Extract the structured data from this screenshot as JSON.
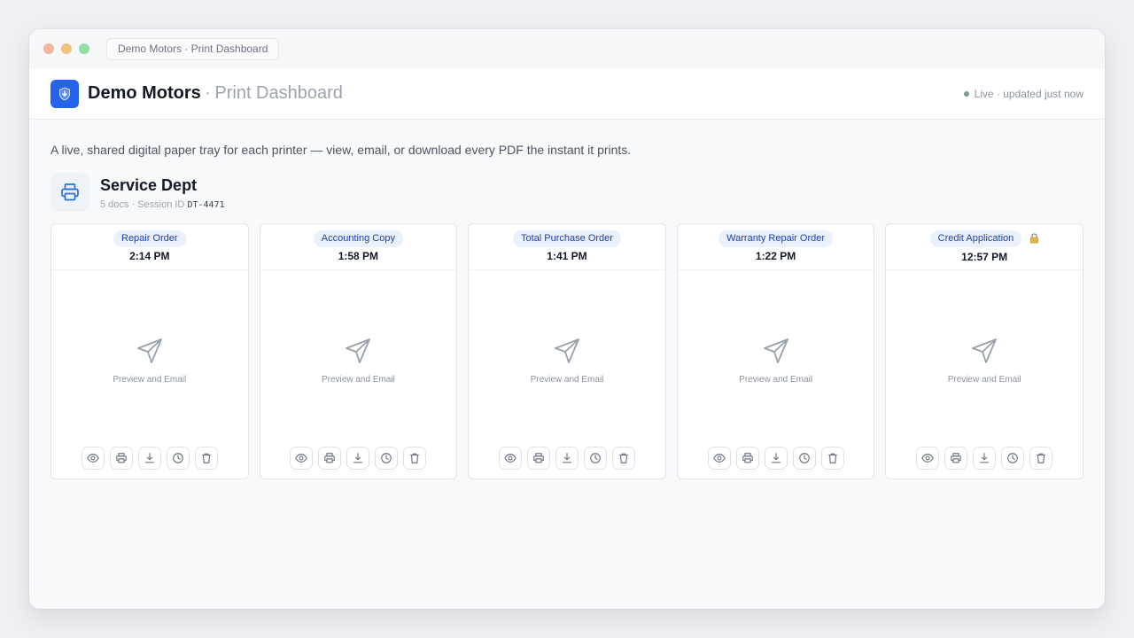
{
  "window": {
    "address": "Demo Motors · Print Dashboard"
  },
  "header": {
    "brand": "Demo Motors",
    "separator": "·",
    "subtitle": "Print Dashboard",
    "status": "Live · updated just now",
    "logo_icon": "download-shield-icon"
  },
  "tagline": "A live, shared digital paper tray for each printer — view, email, or download every PDF the instant it prints.",
  "department": {
    "name": "Service Dept",
    "meta": "5 docs · Session ID",
    "session_id": "DT-4471",
    "icon": "printer-icon"
  },
  "cards": [
    {
      "title": "Repair Order",
      "time": "2:14 PM",
      "locked": false,
      "preview_label": "Preview and Email"
    },
    {
      "title": "Accounting Copy",
      "time": "1:58 PM",
      "locked": false,
      "preview_label": "Preview and Email"
    },
    {
      "title": "Total Purchase Order",
      "time": "1:41 PM",
      "locked": false,
      "preview_label": "Preview and Email"
    },
    {
      "title": "Warranty Repair Order",
      "time": "1:22 PM",
      "locked": false,
      "preview_label": "Preview and Email"
    },
    {
      "title": "Credit Application",
      "time": "12:57 PM",
      "locked": true,
      "preview_label": "Preview and Email"
    }
  ],
  "card_actions": [
    "eye-icon",
    "printer-icon",
    "download-icon",
    "clock-icon",
    "trash-icon"
  ],
  "colors": {
    "accent": "#2563eb",
    "badge_bg": "#eaf1fd",
    "badge_text": "#1e40af"
  }
}
